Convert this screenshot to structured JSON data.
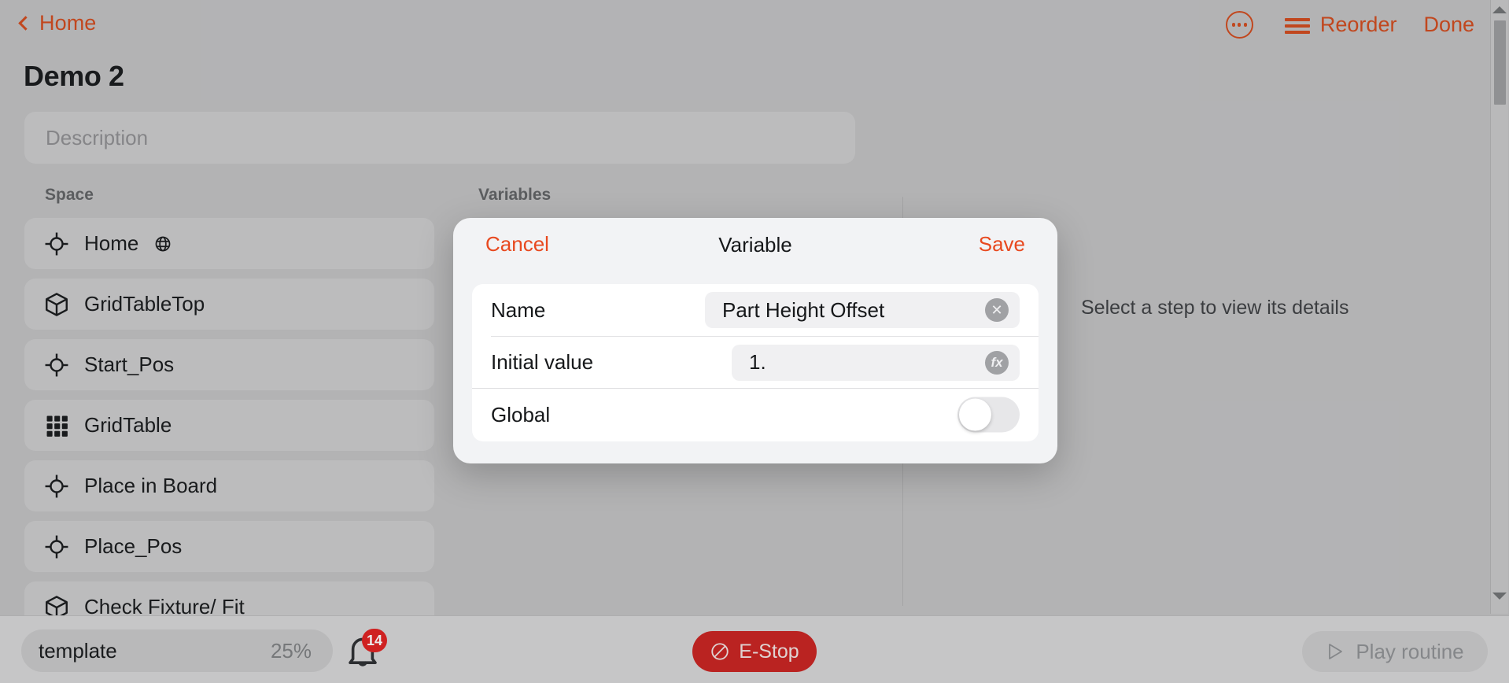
{
  "header": {
    "back_label": "Home",
    "back_icon": "chevron-left-icon",
    "more_icon": "ellipsis-circle-icon",
    "reorder_icon": "hamburger-icon",
    "reorder_label": "Reorder",
    "done_label": "Done"
  },
  "routine": {
    "title": "Demo 2",
    "description_placeholder": "Description"
  },
  "columns": {
    "space_header": "Space",
    "variables_header": "Variables"
  },
  "space_items": [
    {
      "label": "Home",
      "icon": "target-crosshair-icon",
      "badge_icon": "globe-icon"
    },
    {
      "label": "GridTableTop",
      "icon": "cube-icon",
      "badge_icon": ""
    },
    {
      "label": "Start_Pos",
      "icon": "target-crosshair-icon",
      "badge_icon": ""
    },
    {
      "label": "GridTable",
      "icon": "grid-dots-icon",
      "badge_icon": ""
    },
    {
      "label": "Place in Board",
      "icon": "target-crosshair-icon",
      "badge_icon": ""
    },
    {
      "label": "Place_Pos",
      "icon": "target-crosshair-icon",
      "badge_icon": ""
    },
    {
      "label": "Check Fixture/ Fit",
      "icon": "cube-icon",
      "badge_icon": ""
    }
  ],
  "detail_pane": {
    "empty_hint": "Select a step to view its details"
  },
  "modal": {
    "cancel_label": "Cancel",
    "title": "Variable",
    "save_label": "Save",
    "rows": {
      "name_label": "Name",
      "name_value": "Part Height Offset",
      "name_clear_icon": "clear-circle-icon",
      "initial_value_label": "Initial value",
      "initial_value": "1.",
      "formula_icon": "fx-icon",
      "global_label": "Global",
      "global_enabled": "off"
    }
  },
  "bottom_bar": {
    "template_name": "template",
    "template_percent": "25%",
    "bell_icon": "bell-icon",
    "notification_count": "14",
    "estop_label": "E-Stop",
    "estop_icon": "no-entry-icon",
    "play_label": "Play routine",
    "play_icon": "play-triangle-icon"
  },
  "colors": {
    "accent_orange": "#d1491b",
    "modal_accent": "#e8491f",
    "estop_red": "#c9211f",
    "badge_red": "#e01f1f",
    "page_bg": "#c1c1c2"
  }
}
